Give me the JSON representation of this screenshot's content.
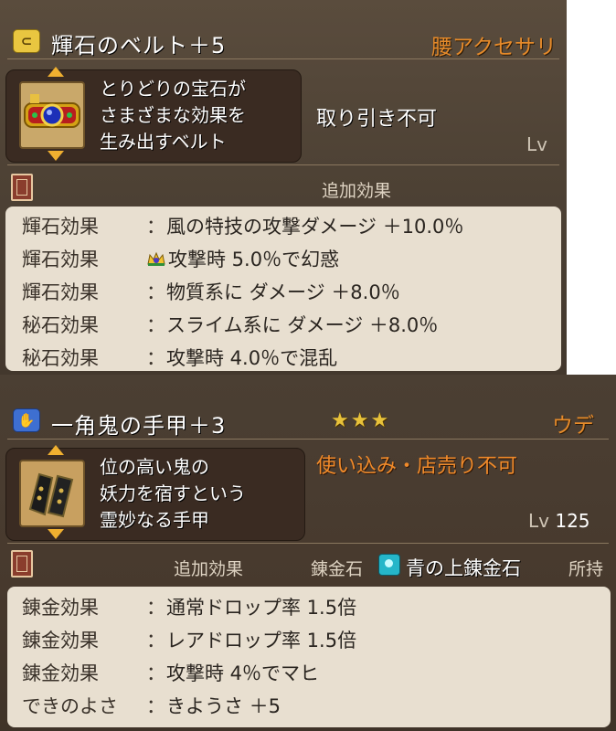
{
  "item1": {
    "icon": "belt-type-icon",
    "name": "輝石のベルト＋5",
    "category": "腰アクセサリ",
    "description": [
      "とりどりの宝石が",
      "さまざまな効果を",
      "生み出すベルト"
    ],
    "trade_status": "取り引き不可",
    "level_label": "Lv",
    "effects_title": "追加効果",
    "effects": [
      {
        "label": "輝石効果",
        "sep": "：",
        "value": "風の特技の攻撃ダメージ ＋10.0％"
      },
      {
        "label": "輝石効果",
        "sep": "",
        "value": "攻撃時 5.0％で幻惑",
        "icon": "crown-icon"
      },
      {
        "label": "輝石効果",
        "sep": "：",
        "value": "物質系に ダメージ ＋8.0％"
      },
      {
        "label": "秘石効果",
        "sep": "：",
        "value": "スライム系に ダメージ ＋8.0％"
      },
      {
        "label": "秘石効果",
        "sep": "：",
        "value": "攻撃時 4.0％で混乱"
      }
    ],
    "colors": {
      "category": "#e58a2a",
      "trade": "#ffffff"
    }
  },
  "item2": {
    "icon": "glove-type-icon",
    "name": "一角鬼の手甲＋3",
    "stars": "★★★",
    "category": "ウデ",
    "description": [
      "位の高い鬼の",
      "妖力を宿すという",
      "霊妙なる手甲"
    ],
    "trade_status": "使い込み・店売り不可",
    "level_label": "Lv",
    "level_value": "125",
    "effects_title": "追加効果",
    "alchemy_stone_label": "錬金石",
    "alchemy_stone_name": "青の上錬金石",
    "owned_label": "所持",
    "effects": [
      {
        "label": "錬金効果",
        "sep": "：",
        "value": "通常ドロップ率 1.5倍"
      },
      {
        "label": "錬金効果",
        "sep": "：",
        "value": "レアドロップ率 1.5倍"
      },
      {
        "label": "錬金効果",
        "sep": "：",
        "value": "攻撃時 4％でマヒ"
      },
      {
        "label": "できのよさ",
        "sep": "：",
        "value": "きようさ ＋5"
      }
    ],
    "colors": {
      "category": "#e58a2a",
      "trade": "#f08a2a",
      "stars": "#e8c23a"
    }
  }
}
